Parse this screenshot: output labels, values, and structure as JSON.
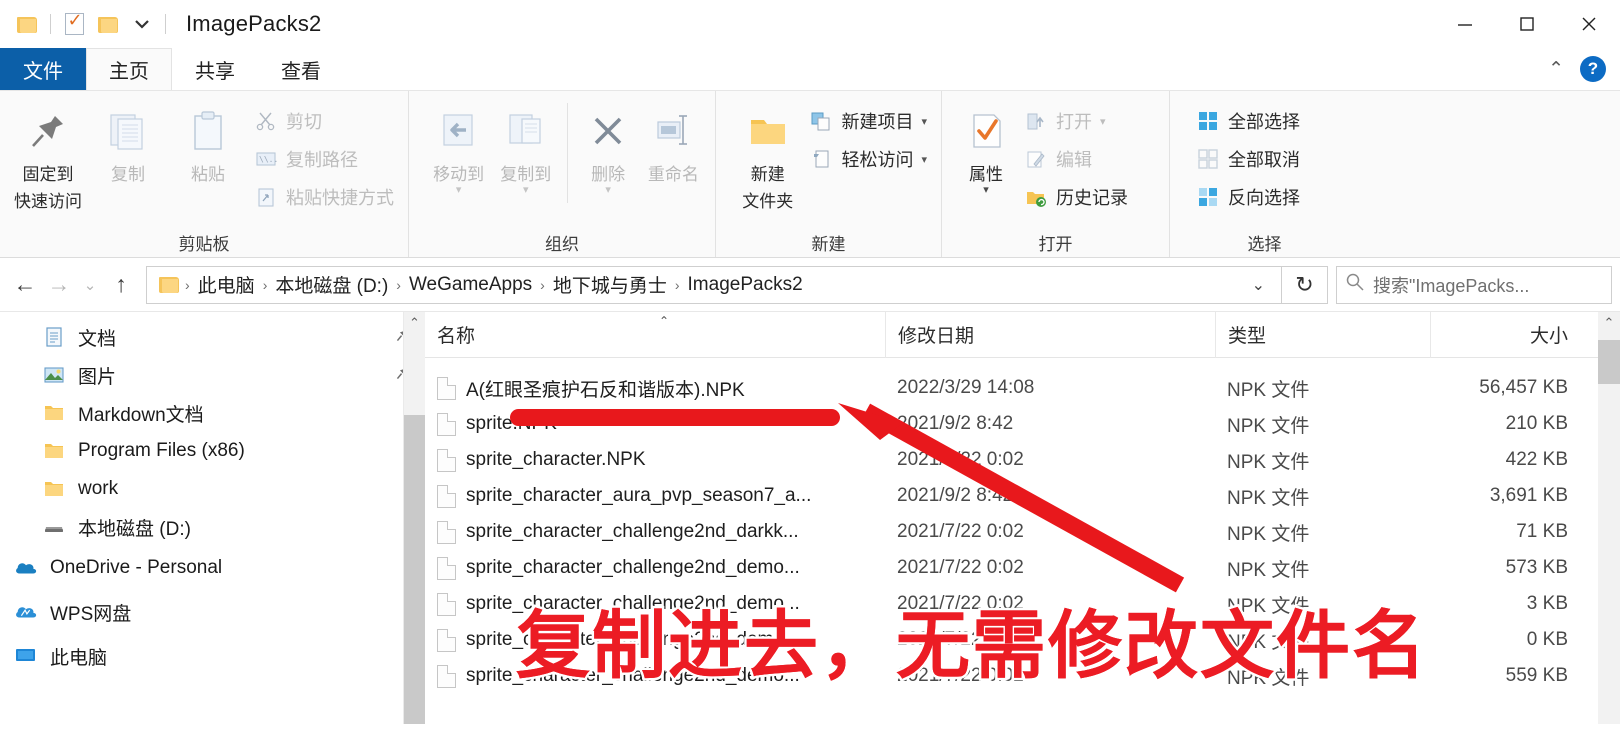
{
  "window": {
    "title": "ImagePacks2",
    "quick_access": [
      {
        "name": "folder-icon"
      },
      {
        "name": "properties-check-icon"
      },
      {
        "name": "new-folder-icon"
      },
      {
        "name": "chevron-down-icon"
      }
    ],
    "controls": {
      "minimize": "—",
      "maximize": "☐",
      "close": "✕"
    }
  },
  "ribbon": {
    "tabs": [
      {
        "label": "文件",
        "id": "file"
      },
      {
        "label": "主页",
        "id": "home"
      },
      {
        "label": "共享",
        "id": "share"
      },
      {
        "label": "查看",
        "id": "view"
      }
    ],
    "collapse_icon": "⌃",
    "help_icon": "?",
    "groups": [
      {
        "label": "剪贴板",
        "big": [
          {
            "label": "固定到\n快速访问",
            "line1": "固定到",
            "line2": "快速访问",
            "icon": "pin-icon"
          },
          {
            "label": "复制",
            "line1": "复制",
            "line2": "",
            "icon": "copy-icon",
            "dim": true
          },
          {
            "label": "粘贴",
            "line1": "粘贴",
            "line2": "",
            "icon": "paste-icon",
            "dim": true
          }
        ],
        "small": [
          {
            "label": "剪切",
            "icon": "scissors-icon",
            "dim": true
          },
          {
            "label": "复制路径",
            "icon": "copy-path-icon",
            "dim": true
          },
          {
            "label": "粘贴快捷方式",
            "icon": "paste-shortcut-icon",
            "dim": true
          }
        ]
      },
      {
        "label": "组织",
        "big": [
          {
            "line1": "移动到",
            "line2": "",
            "icon": "move-to-icon",
            "dim": true,
            "caret": true
          },
          {
            "line1": "复制到",
            "line2": "",
            "icon": "copy-to-icon",
            "dim": true,
            "caret": true
          },
          {
            "line1": "删除",
            "line2": "",
            "icon": "delete-x-icon",
            "dim": true,
            "caret": true
          },
          {
            "line1": "重命名",
            "line2": "",
            "icon": "rename-icon",
            "dim": true
          }
        ],
        "small": []
      },
      {
        "label": "新建",
        "big": [
          {
            "line1": "新建",
            "line2": "文件夹",
            "icon": "new-folder-icon"
          }
        ],
        "small": [
          {
            "label": "新建项目",
            "icon": "new-item-icon",
            "caret": true
          },
          {
            "label": "轻松访问",
            "icon": "easy-access-icon",
            "caret": true
          }
        ]
      },
      {
        "label": "打开",
        "big": [
          {
            "line1": "属性",
            "line2": "",
            "icon": "properties-icon",
            "caret": true
          }
        ],
        "small": [
          {
            "label": "打开",
            "icon": "open-icon",
            "dim": true,
            "caret": true
          },
          {
            "label": "编辑",
            "icon": "edit-icon",
            "dim": true
          },
          {
            "label": "历史记录",
            "icon": "history-icon"
          }
        ]
      },
      {
        "label": "选择",
        "big": [],
        "small": [
          {
            "label": "全部选择",
            "icon": "select-all-icon"
          },
          {
            "label": "全部取消",
            "icon": "select-none-icon"
          },
          {
            "label": "反向选择",
            "icon": "invert-selection-icon"
          }
        ]
      }
    ]
  },
  "address": {
    "back_icon": "←",
    "forward_icon": "→",
    "recent_icon": "⌄",
    "up_icon": "↑",
    "breadcrumbs": [
      "此电脑",
      "本地磁盘 (D:)",
      "WeGameApps",
      "地下城与勇士",
      "ImagePacks2"
    ],
    "separator": "›",
    "dropdown_icon": "⌄",
    "refresh_icon": "↻",
    "search_icon": "⚲",
    "search_placeholder": "搜索\"ImagePacks..."
  },
  "nav_pane": {
    "items": [
      {
        "label": "文档",
        "icon": "documents-icon",
        "indent": 1,
        "pinned": true
      },
      {
        "label": "图片",
        "icon": "pictures-icon",
        "indent": 1,
        "pinned": true
      },
      {
        "label": "Markdown文档",
        "icon": "folder-icon",
        "indent": 1,
        "pinned": false
      },
      {
        "label": "Program Files (x86)",
        "icon": "folder-icon",
        "indent": 1,
        "pinned": false
      },
      {
        "label": "work",
        "icon": "folder-icon",
        "indent": 1,
        "pinned": false
      },
      {
        "label": "本地磁盘 (D:)",
        "icon": "drive-icon",
        "indent": 1,
        "pinned": false
      },
      {
        "label": "OneDrive - Personal",
        "icon": "onedrive-icon",
        "indent": 0,
        "pinned": false
      },
      {
        "label": "WPS网盘",
        "icon": "wps-cloud-icon",
        "indent": 0,
        "pinned": false
      },
      {
        "label": "此电脑",
        "icon": "this-pc-icon",
        "indent": 0,
        "pinned": false
      }
    ],
    "scroll_up_icon": "⌃"
  },
  "file_list": {
    "columns": [
      {
        "key": "name",
        "label": "名称"
      },
      {
        "key": "date",
        "label": "修改日期"
      },
      {
        "key": "type",
        "label": "类型"
      },
      {
        "key": "size",
        "label": "大小"
      }
    ],
    "sort_indicator": "⌃",
    "scroll_up_icon": "⌃",
    "rows": [
      {
        "name": "A(红眼圣痕护石反和谐版本).NPK",
        "date": "2022/3/29 14:08",
        "type": "NPK 文件",
        "size": "56,457 KB"
      },
      {
        "name": "sprite.NPK",
        "date": "2021/9/2 8:42",
        "type": "NPK 文件",
        "size": "210 KB"
      },
      {
        "name": "sprite_character.NPK",
        "date": "2021/7/22 0:02",
        "type": "NPK 文件",
        "size": "422 KB"
      },
      {
        "name": "sprite_character_aura_pvp_season7_a...",
        "date": "2021/9/2 8:42",
        "type": "NPK 文件",
        "size": "3,691 KB"
      },
      {
        "name": "sprite_character_challenge2nd_darkk...",
        "date": "2021/7/22 0:02",
        "type": "NPK 文件",
        "size": "71 KB"
      },
      {
        "name": "sprite_character_challenge2nd_demo...",
        "date": "2021/7/22 0:02",
        "type": "NPK 文件",
        "size": "573 KB"
      },
      {
        "name": "sprite_character_challenge2nd_demo...",
        "date": "2021/7/22 0:02",
        "type": "NPK 文件",
        "size": "3 KB"
      },
      {
        "name": "sprite_character_challenge2nd_demo...",
        "date": "2021/7/22 0:02",
        "type": "NPK 文件",
        "size": "0 KB"
      },
      {
        "name": "sprite_character_challenge2nd_demo...",
        "date": "2021/7/22 0:02",
        "type": "NPK 文件",
        "size": "559 KB"
      }
    ]
  },
  "annotations": {
    "underline": {
      "color": "#e8181c"
    },
    "arrow": {
      "color": "#e8181c"
    },
    "callout_text": "复制进去，无需修改文件名",
    "callout_color": "#ec1c24"
  },
  "colors": {
    "accent_blue": "#0c5fa8",
    "annotation_red": "#ec1c24",
    "folder_yellow": "#fcd682"
  }
}
